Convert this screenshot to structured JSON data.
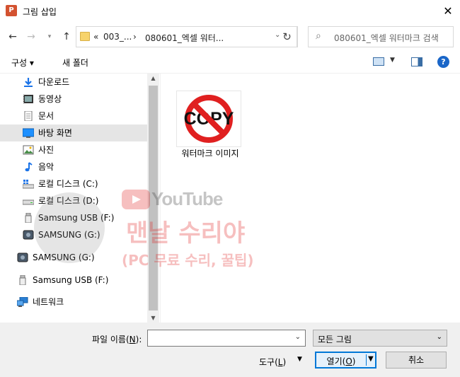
{
  "window": {
    "title": "그림 삽입",
    "app_icon": "powerpoint-icon"
  },
  "address": {
    "crumbs": [
      "«",
      "003_...",
      "›",
      "080601_엑셀 워터..."
    ],
    "search_placeholder": "080601_엑셀 워터마크 검색"
  },
  "toolbar": {
    "organize": "구성 ▾",
    "new_folder": "새 폴더"
  },
  "navpane": {
    "items": [
      {
        "label": "다운로드",
        "icon": "download-icon"
      },
      {
        "label": "동영상",
        "icon": "video-icon"
      },
      {
        "label": "문서",
        "icon": "document-icon"
      },
      {
        "label": "바탕 화면",
        "icon": "desktop-icon",
        "selected": true
      },
      {
        "label": "사진",
        "icon": "pictures-icon"
      },
      {
        "label": "음악",
        "icon": "music-icon"
      },
      {
        "label": "로컬 디스크 (C:)",
        "icon": "windows-drive-icon"
      },
      {
        "label": "로컬 디스크 (D:)",
        "icon": "drive-icon"
      },
      {
        "label": "Samsung USB (F:)",
        "icon": "usb-drive-icon"
      },
      {
        "label": "SAMSUNG (G:)",
        "icon": "external-drive-icon"
      },
      {
        "label": "SAMSUNG (G:)",
        "icon": "external-drive-icon"
      },
      {
        "label": "Samsung USB (F:)",
        "icon": "usb-drive-icon"
      },
      {
        "label": "네트워크",
        "icon": "network-icon"
      }
    ]
  },
  "files": [
    {
      "name": "워터마크 이미지",
      "thumbnail_text": "COPY"
    }
  ],
  "watermark": {
    "brand": "YouTube",
    "title": "맨날 수리야",
    "subtitle": "(PC 무료 수리, 꿀팁)"
  },
  "bottom": {
    "filename_label_prefix": "파일 이름(",
    "filename_label_key": "N",
    "filename_label_suffix": "):",
    "filename_value": "",
    "filter_value": "모든 그림",
    "tools_prefix": "도구(",
    "tools_key": "L",
    "tools_suffix": ")",
    "open_prefix": "열기(",
    "open_key": "O",
    "open_suffix": ")",
    "cancel": "취소"
  },
  "colors": {
    "accent": "#0078d7",
    "selected_bg": "#e5e5e5",
    "bottom_bg": "#f0f0f0",
    "copy_red": "#e02020"
  }
}
